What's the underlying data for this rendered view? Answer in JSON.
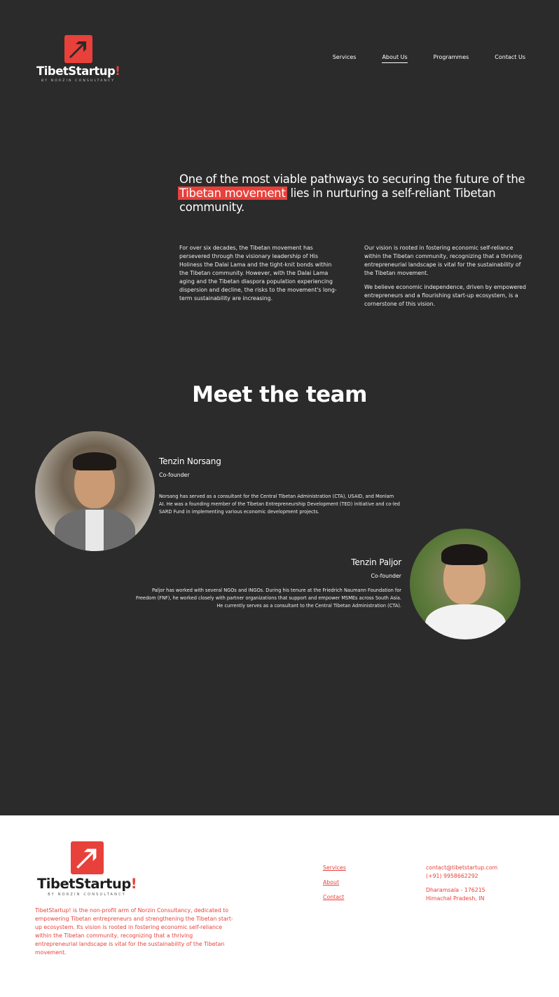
{
  "brand": {
    "name_main": "TibetStartup",
    "name_bang": "!",
    "tagline": "BY NORZIN CONSULTANCY",
    "accent_color": "#e8403a",
    "logo_icon": "arrow-up-right-icon"
  },
  "nav": {
    "items": [
      {
        "label": "Services",
        "active": false
      },
      {
        "label": "About Us",
        "active": true
      },
      {
        "label": "Programmes",
        "active": false
      },
      {
        "label": "Contact Us",
        "active": false
      }
    ]
  },
  "hero": {
    "pre": "One of the most viable pathways to securing the future of the ",
    "highlight": "Tibetan movement",
    "post": " lies in nurturing a self-reliant Tibetan community."
  },
  "intro": {
    "col1": [
      "For over six decades, the Tibetan movement has persevered through the visionary leadership of His Holiness the Dalai Lama and the tight-knit bonds within the Tibetan community. However, with the Dalai Lama aging and the Tibetan diaspora population experiencing dispersion and decline, the risks to the movement's long-term sustainability are increasing."
    ],
    "col2": [
      "Our vision is rooted in fostering economic self-reliance within the Tibetan community, recognizing that a thriving entrepreneurial landscape is vital for the sustainability of the Tibetan movement.",
      "We believe economic independence, driven by empowered entrepreneurs and a flourishing start-up ecosystem, is a cornerstone of this vision."
    ]
  },
  "team": {
    "title": "Meet the team",
    "members": [
      {
        "name": "Tenzin Norsang",
        "role": "Co-founder",
        "bio": "Norsang has served as a consultant for the Central Tibetan Administration (CTA), USAID, and Monlam AI. He was a founding member of the Tibetan Entrepreneurship Development (TED) initiative and co-led SARD Fund in implementing various economic development projects."
      },
      {
        "name": "Tenzin Paljor",
        "role": "Co-founder",
        "bio": "Paljor has worked with several NGOs and INGOs. During his tenure at the Friedrich Naumann Foundation for Freedom (FNF), he worked closely with partner organizations that support and empower MSMEs across South Asia. He currently serves as a consultant to the Central Tibetan Administration (CTA)."
      }
    ]
  },
  "footer": {
    "about": "TibetStartup! is the non-profit arm of Norzin Consultancy, dedicated to empowering Tibetan entrepreneurs and strengthening the Tibetan start-up ecosystem. Its vision is rooted in fostering economic self-reliance within the Tibetan community, recognizing that a thriving entrepreneurial landscape is vital for the sustainability of the Tibetan movement.",
    "links": [
      "Services",
      "About",
      "Contact"
    ],
    "email": "contact@tibetstartup.com",
    "phone": "(+91) 9958662292",
    "address_line1": "Dharamsala - 176215",
    "address_line2": "Himachal Pradesh, IN"
  }
}
